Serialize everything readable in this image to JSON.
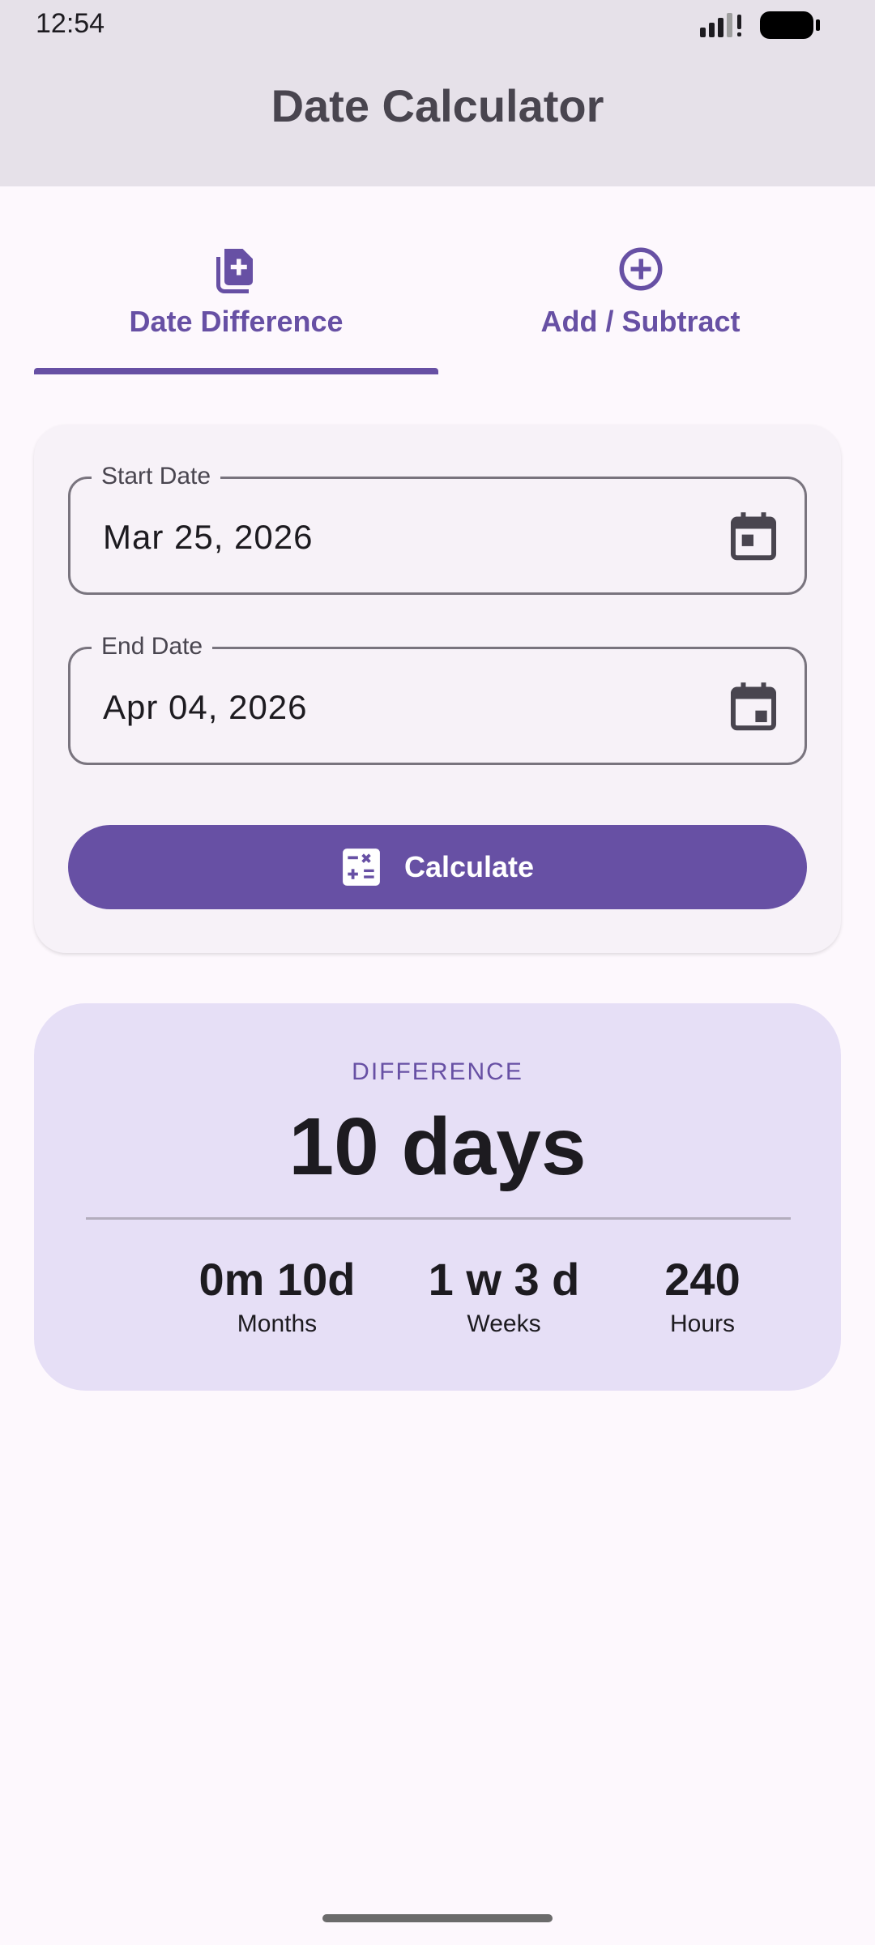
{
  "status_bar": {
    "time": "12:54"
  },
  "app_bar": {
    "title": "Date Calculator"
  },
  "tabs": [
    {
      "label": "Date Difference",
      "icon": "note-add-icon",
      "selected": true
    },
    {
      "label": "Add / Subtract",
      "icon": "add-circle-icon",
      "selected": false
    }
  ],
  "form": {
    "start_date": {
      "label": "Start Date",
      "value": "Mar 25, 2026",
      "icon": "calendar-icon"
    },
    "end_date": {
      "label": "End Date",
      "value": "Apr 04, 2026",
      "icon": "calendar-icon"
    },
    "calculate_button": {
      "label": "Calculate",
      "icon": "calculate-icon"
    }
  },
  "result": {
    "caption": "DIFFERENCE",
    "main": "10 days",
    "stats": [
      {
        "value": "0m 10d",
        "label": "Months"
      },
      {
        "value": "1 w 3 d",
        "label": "Weeks"
      },
      {
        "value": "240",
        "label": "Hours"
      }
    ]
  },
  "colors": {
    "primary": "#6750a4",
    "app_bar": "#e6e1e9",
    "result_card": "#e6dff6",
    "background": "#fdf8fd"
  }
}
